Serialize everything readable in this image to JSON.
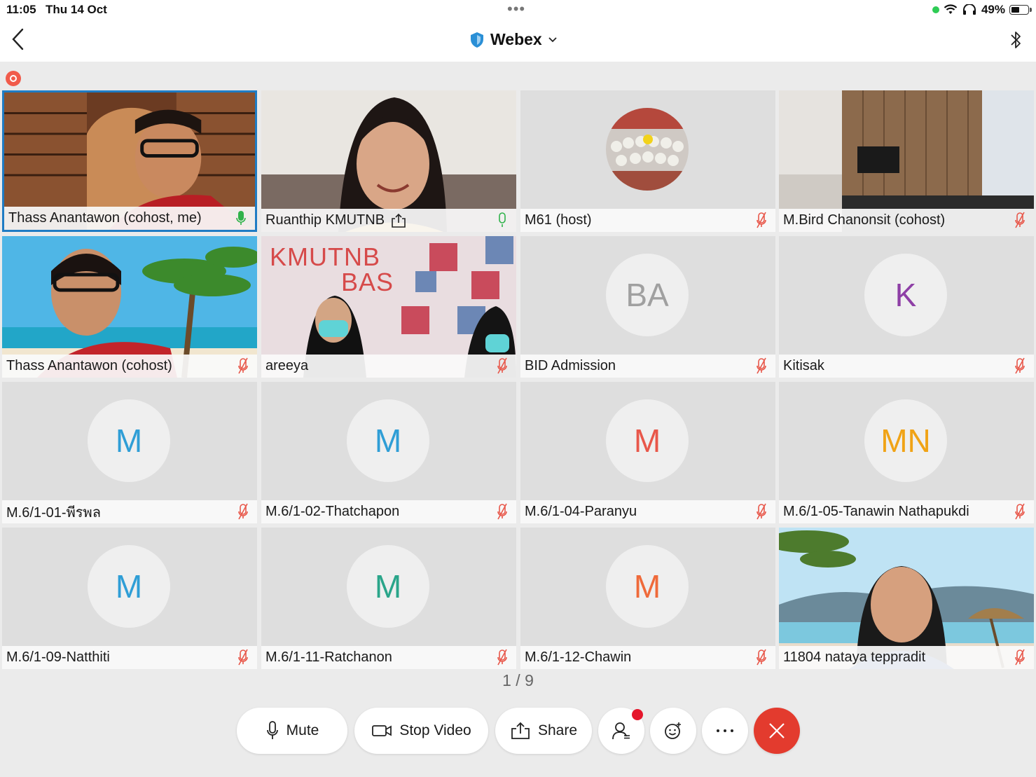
{
  "status": {
    "time": "11:05",
    "date": "Thu 14 Oct",
    "battery": "49%",
    "battery_level": 0.49
  },
  "header": {
    "title": "Webex"
  },
  "participants": [
    {
      "name": "Thass Anantawon (cohost, me)",
      "mic": "on",
      "type": "video"
    },
    {
      "name": "Ruanthip KMUTNB",
      "mic": "on",
      "type": "video",
      "sharing": true
    },
    {
      "name": "M61 (host)",
      "mic": "muted",
      "type": "photo-avatar"
    },
    {
      "name": "M.Bird Chanonsit (cohost)",
      "mic": "muted",
      "type": "video"
    },
    {
      "name": "Thass Anantawon (cohost)",
      "mic": "muted",
      "type": "video"
    },
    {
      "name": "areeya",
      "mic": "muted",
      "type": "video",
      "banner_line1": "KMUTNB",
      "banner_line2": "BAS"
    },
    {
      "name": "BID Admission",
      "mic": "muted",
      "type": "initials",
      "initials": "BA",
      "color": "#a0a0a0"
    },
    {
      "name": "Kitisak",
      "mic": "muted",
      "type": "initials",
      "initials": "K",
      "color": "#8e3fa6"
    },
    {
      "name": "M.6/1-01-พีรพล",
      "mic": "muted",
      "type": "initials",
      "initials": "M",
      "color": "#2f9ed6"
    },
    {
      "name": "M.6/1-02-Thatchapon",
      "mic": "muted",
      "type": "initials",
      "initials": "M",
      "color": "#2f9ed6"
    },
    {
      "name": "M.6/1-04-Paranyu",
      "mic": "muted",
      "type": "initials",
      "initials": "M",
      "color": "#e8574a"
    },
    {
      "name": "M.6/1-05-Tanawin Nathapukdi",
      "mic": "muted",
      "type": "initials",
      "initials": "MN",
      "color": "#f0a316"
    },
    {
      "name": "M.6/1-09-Natthiti",
      "mic": "muted",
      "type": "initials",
      "initials": "M",
      "color": "#2f9ed6"
    },
    {
      "name": "M.6/1-11-Ratchanon",
      "mic": "muted",
      "type": "initials",
      "initials": "M",
      "color": "#2aa58a"
    },
    {
      "name": "M.6/1-12-Chawin",
      "mic": "muted",
      "type": "initials",
      "initials": "M",
      "color": "#ef6a3a"
    },
    {
      "name": "11804 nataya teppradit",
      "mic": "muted",
      "type": "video"
    }
  ],
  "pager": "1 / 9",
  "controls": {
    "mute_label": "Mute",
    "stop_video_label": "Stop Video",
    "share_label": "Share"
  }
}
